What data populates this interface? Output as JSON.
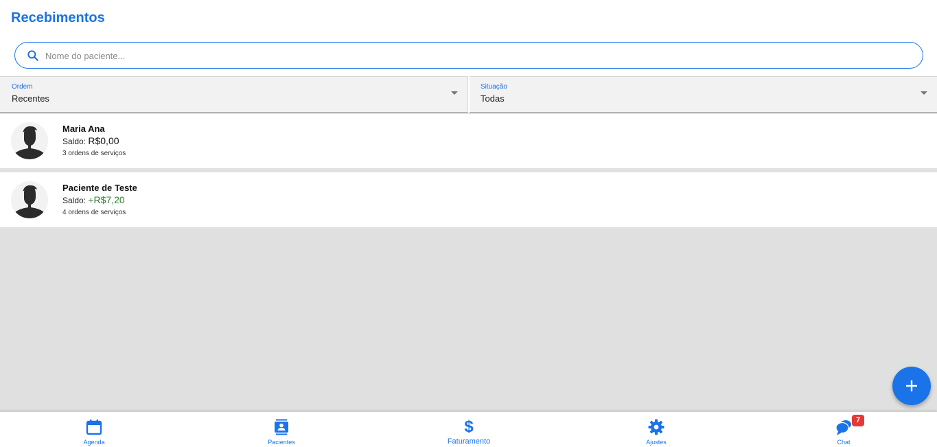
{
  "header": {
    "title": "Recebimentos"
  },
  "search": {
    "placeholder": "Nome do paciente...",
    "value": ""
  },
  "filters": {
    "ordem": {
      "label": "Ordem",
      "value": "Recentes"
    },
    "situacao": {
      "label": "Situação",
      "value": "Todas"
    }
  },
  "patients": [
    {
      "name": "Maria Ana",
      "saldo_label": "Saldo:",
      "saldo_value": "R$0,00",
      "orders": "3 ordens de serviços"
    },
    {
      "name": "Paciente de Teste",
      "saldo_label": "Saldo:",
      "saldo_value": "+R$7,20",
      "orders": "4 ordens de serviços"
    }
  ],
  "fab": {
    "icon": "plus-icon"
  },
  "bottom_nav": {
    "items": [
      {
        "label": "Agenda",
        "icon": "calendar-icon"
      },
      {
        "label": "Pacientes",
        "icon": "contacts-icon"
      },
      {
        "label": "Faturamento",
        "icon": "dollar-icon",
        "active": true
      },
      {
        "label": "Ajustes",
        "icon": "gear-icon"
      },
      {
        "label": "Chat",
        "icon": "chat-icon",
        "badge": "7"
      }
    ]
  },
  "colors": {
    "accent": "#1a73e8",
    "positive": "#2e7d32",
    "badge": "#e53935",
    "background": "#e0e0e0"
  }
}
